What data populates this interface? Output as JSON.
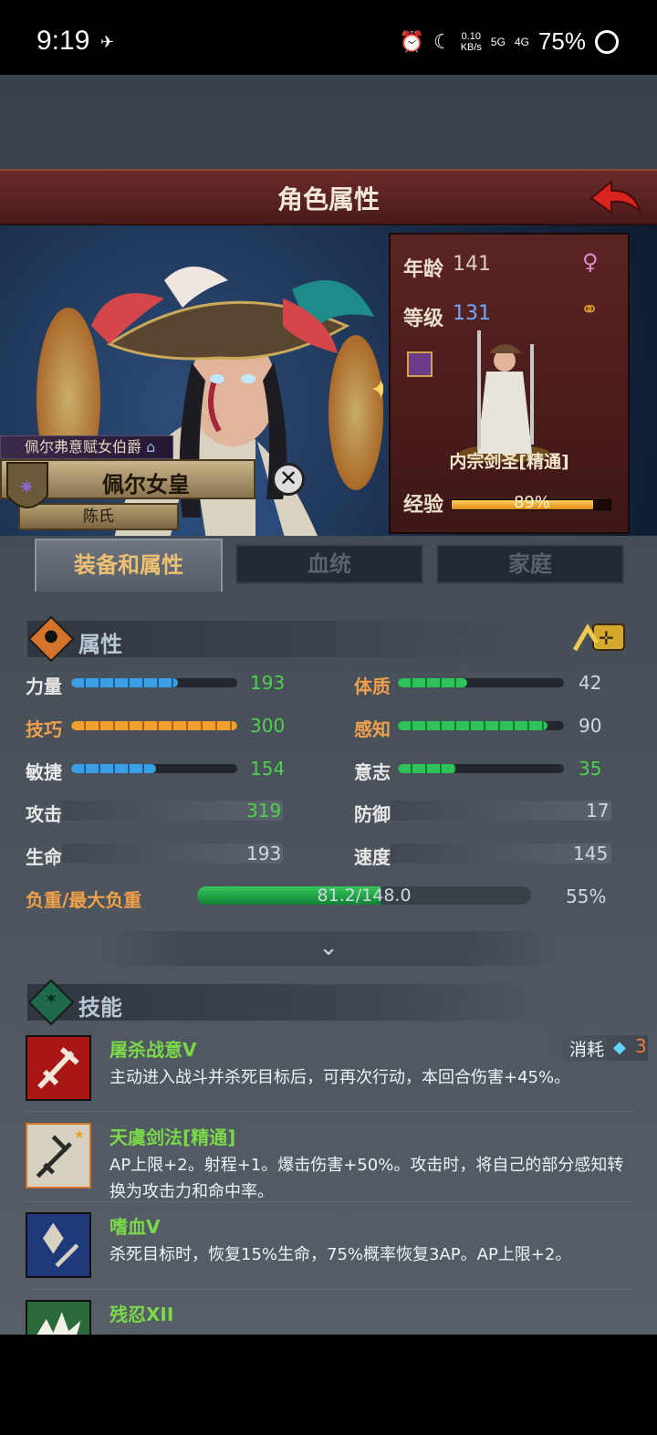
{
  "status_bar": {
    "time": "9:19",
    "net_speed": "0.10",
    "net_unit": "KB/s",
    "sig1": "5G",
    "sig2": "4G",
    "battery": "75%"
  },
  "header": {
    "title": "角色属性"
  },
  "character": {
    "noble_title": "佩尔弗意赋女伯爵",
    "name": "佩尔女皇",
    "clan": "陈氏"
  },
  "info": {
    "age_label": "年龄",
    "age": "141",
    "level_label": "等级",
    "level": "131",
    "class_name": "内宗剑圣[精通]",
    "xp_label": "经验",
    "xp_text": "89%",
    "xp_fraction": 0.89
  },
  "tabs": [
    {
      "label": "装备和属性",
      "active": true
    },
    {
      "label": "血统",
      "active": false
    },
    {
      "label": "家庭",
      "active": false
    }
  ],
  "attributes_section": {
    "title": "属性",
    "attrs": [
      {
        "label": "力量",
        "value": "193",
        "max": 300,
        "color": "blue"
      },
      {
        "label": "技巧",
        "value": "300",
        "max": 300,
        "color": "orange"
      },
      {
        "label": "敏捷",
        "value": "154",
        "max": 300,
        "color": "blue"
      },
      {
        "label": "体质",
        "value": "42",
        "max": 100,
        "color": "green"
      },
      {
        "label": "感知",
        "value": "90",
        "max": 100,
        "color": "green"
      },
      {
        "label": "意志",
        "value": "35",
        "max": 100,
        "color": "green"
      }
    ],
    "derived": [
      {
        "label": "攻击",
        "value": "319"
      },
      {
        "label": "生命",
        "value": "193"
      },
      {
        "label": "防御",
        "value": "17"
      },
      {
        "label": "速度",
        "value": "145"
      }
    ],
    "load_label": "负重/最大负重",
    "load_text": "81.2/148.0",
    "load_fraction": 0.55,
    "load_percent": "55%"
  },
  "skills_section": {
    "title": "技能",
    "cost_label": "消耗",
    "cost_value": "3",
    "skills": [
      {
        "name": "屠杀战意V",
        "desc": "主动进入战斗并杀死目标后，可再次行动，本回合伤害+45%。"
      },
      {
        "name": "天虞剑法[精通]",
        "desc": "AP上限+2。射程+1。爆击伤害+50%。攻击时，将自己的部分感知转换为攻击力和命中率。"
      },
      {
        "name": "嗜血V",
        "desc": "杀死目标时，恢复15%生命，75%概率恢复3AP。AP上限+2。"
      },
      {
        "name": "残忍XII",
        "desc": ""
      }
    ]
  },
  "colors": {
    "accent_orange": "#f0a04a",
    "skill_green": "#7bd84a",
    "level_blue": "#6ea9ff",
    "title_red": "#5c2424"
  }
}
